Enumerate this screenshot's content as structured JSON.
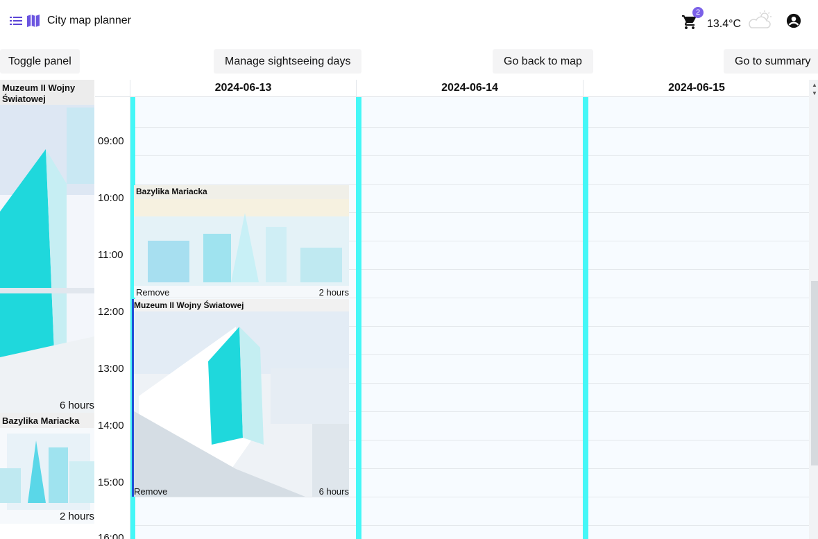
{
  "header": {
    "title": "City map planner",
    "cart_count": "2",
    "temperature": "13.4°C",
    "icons": [
      "menu-list-icon",
      "map-icon",
      "cart-icon",
      "partly-cloudy-icon",
      "account-icon"
    ]
  },
  "toolbar": {
    "toggle_panel": "Toggle panel",
    "manage_days": "Manage sightseeing days",
    "back_to_map": "Go back to map",
    "summary": "Go to summary"
  },
  "panel": {
    "items": [
      {
        "title": "Muzeum II Wojny Światowej",
        "duration": "6 hours"
      },
      {
        "title": "Bazylika Mariacka",
        "duration": "2 hours"
      }
    ]
  },
  "calendar": {
    "days": [
      "2024-06-13",
      "2024-06-14",
      "2024-06-15"
    ],
    "times": [
      "09:00",
      "10:00",
      "11:00",
      "12:00",
      "13:00",
      "14:00",
      "15:00",
      "16:00"
    ],
    "events": [
      {
        "title": "Bazylika Mariacka",
        "remove": "Remove",
        "duration": "2 hours",
        "day": "2024-06-13",
        "start": "10:00",
        "end": "12:00"
      },
      {
        "title": "Muzeum II Wojny Światowej",
        "remove": "Remove",
        "duration": "6 hours",
        "day": "2024-06-13",
        "start": "12:00",
        "end": "15:30"
      }
    ]
  },
  "colors": {
    "accent": "#7b61e8",
    "day_stripe": "#45f7f7",
    "event_bar": "#1f4fd8"
  }
}
